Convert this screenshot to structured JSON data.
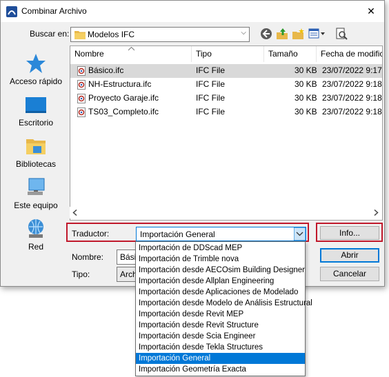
{
  "window": {
    "title": "Combinar Archivo",
    "close_glyph": "✕"
  },
  "lookin": {
    "label": "Buscar en:",
    "value": "Modelos IFC"
  },
  "places": [
    {
      "label": "Acceso rápido",
      "icon": "star-icon"
    },
    {
      "label": "Escritorio",
      "icon": "desktop-icon"
    },
    {
      "label": "Bibliotecas",
      "icon": "libraries-icon"
    },
    {
      "label": "Este equipo",
      "icon": "computer-icon"
    },
    {
      "label": "Red",
      "icon": "network-icon"
    }
  ],
  "columns": {
    "name": "Nombre",
    "type": "Tipo",
    "size": "Tamaño",
    "date": "Fecha de modific"
  },
  "files": [
    {
      "name": "Básico.ifc",
      "type": "IFC File",
      "size": "30 KB",
      "date": "23/07/2022 9:17"
    },
    {
      "name": "NH-Estructura.ifc",
      "type": "IFC File",
      "size": "30 KB",
      "date": "23/07/2022 9:18"
    },
    {
      "name": "Proyecto Garaje.ifc",
      "type": "IFC File",
      "size": "30 KB",
      "date": "23/07/2022 9:18"
    },
    {
      "name": "TS03_Completo.ifc",
      "type": "IFC File",
      "size": "30 KB",
      "date": "23/07/2022 9:18"
    }
  ],
  "translator": {
    "label": "Traductor:",
    "value": "Importación General",
    "options": [
      "Importación de DDScad MEP",
      "Importación de Trimble nova",
      "Importación desde AECOsim Building Designer",
      "Importación desde Allplan Engineering",
      "Importación desde Aplicaciones de Modelado",
      "Importación desde Modelo de Análisis Estructural",
      "Importación desde Revit MEP",
      "Importación desde Revit Structure",
      "Importación desde Scia Engineer",
      "Importación desde Tekla Structures",
      "Importación General",
      "Importación Geometría Exacta"
    ],
    "selected_index": 10
  },
  "buttons": {
    "info": "Info...",
    "open": "Abrir",
    "cancel": "Cancelar"
  },
  "filename": {
    "label": "Nombre:",
    "value": "Básico"
  },
  "filetype": {
    "label": "Tipo:",
    "value": "Archi"
  },
  "colors": {
    "highlight": "#0078d7",
    "callout_frame": "#c0182b",
    "selected_row": "#d9d9d9"
  }
}
